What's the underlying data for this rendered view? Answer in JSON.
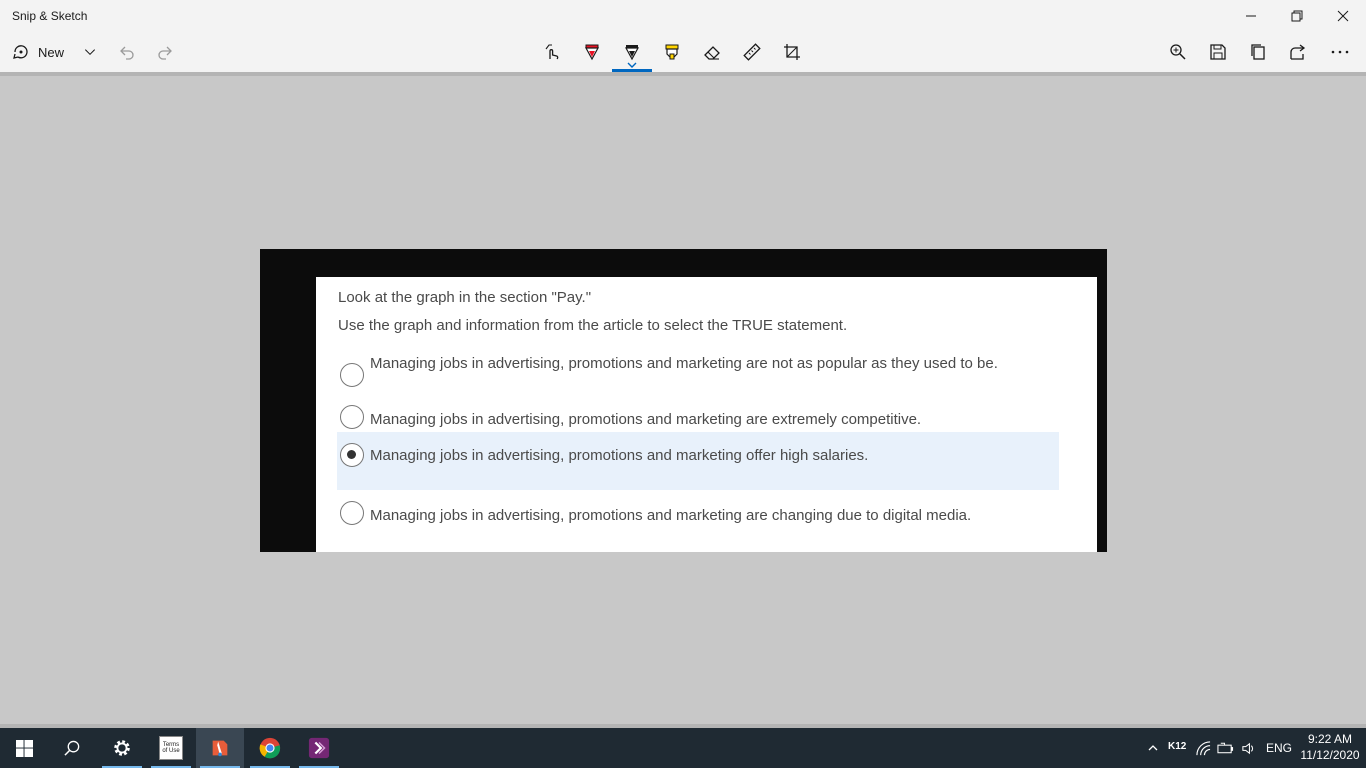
{
  "window": {
    "title": "Snip & Sketch",
    "minimize_glyph": "—",
    "controls": [
      "minimize-icon",
      "restore-icon",
      "close-icon"
    ]
  },
  "toolbar": {
    "new_label": "New",
    "left_tools": [
      "new-snip-icon",
      "chevron-down-icon",
      "undo-icon",
      "redo-icon"
    ],
    "center_tools": [
      "touch-writing-icon",
      "ballpoint-pen-icon",
      "pencil-icon",
      "highlighter-icon",
      "eraser-icon",
      "ruler-icon",
      "crop-icon"
    ],
    "right_tools": [
      "zoom-icon",
      "save-icon",
      "copy-icon",
      "share-icon",
      "more-icon"
    ],
    "active_tool": "pencil-icon",
    "colors": {
      "pen": "#e81123",
      "pencil": "#1a1a1a",
      "highlighter": "#ffd400",
      "accent": "#0067c0"
    }
  },
  "snip": {
    "question_1": "Look at the graph in the section \"Pay.\"",
    "question_2": "Use the graph and information from the article to select the TRUE statement.",
    "options": [
      {
        "text": "Managing jobs in advertising, promotions and marketing are not as popular as they used to be.",
        "selected": false
      },
      {
        "text": "Managing jobs in advertising, promotions and marketing are extremely competitive.",
        "selected": false
      },
      {
        "text": "Managing jobs in advertising, promotions and marketing offer high salaries.",
        "selected": true
      },
      {
        "text": "Managing jobs in advertising, promotions and marketing are changing due to digital media.",
        "selected": false
      }
    ]
  },
  "taskbar": {
    "apps": [
      "windows-start-icon",
      "search-icon",
      "settings-icon",
      "terms-of-use-app-icon",
      "snip-sketch-app-icon",
      "chrome-icon",
      "power-automate-icon"
    ],
    "terms_icon_text": "Terms of Use",
    "tray": {
      "k12_label": "K12",
      "language": "ENG",
      "time": "9:22 AM",
      "date": "11/12/2020"
    }
  }
}
